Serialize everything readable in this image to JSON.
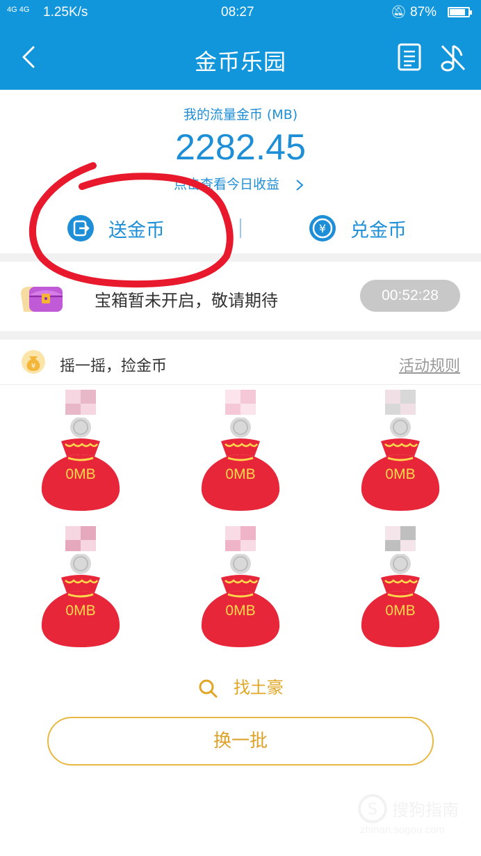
{
  "status_bar": {
    "network": "4G 4G",
    "speed": "1.25K/s",
    "time": "08:27",
    "battery": "87%",
    "battery_level": 0.87
  },
  "header": {
    "title": "金币乐园",
    "back_icon": "chevron-left-icon",
    "icons": [
      "document-icon",
      "music-off-icon"
    ]
  },
  "balance": {
    "label": "我的流量金币 (MB)",
    "value": "2282.45",
    "today_link": "点击查看今日收益"
  },
  "actions": {
    "send_label": "送金币",
    "exchange_label": "兑金币"
  },
  "treasure": {
    "text": "宝箱暂未开启，敬请期待",
    "timer": "00:52:28"
  },
  "shake": {
    "title": "摇一摇，捡金币",
    "rules_label": "活动规则",
    "bags": [
      {
        "amount": "0MB"
      },
      {
        "amount": "0MB"
      },
      {
        "amount": "0MB"
      },
      {
        "amount": "0MB"
      },
      {
        "amount": "0MB"
      },
      {
        "amount": "0MB"
      }
    ]
  },
  "find_rich_label": "找土豪",
  "refresh_label": "换一批",
  "watermark": {
    "name": "搜狗指南",
    "url": "zhinan.sogou.com"
  },
  "colors": {
    "primary": "#1296db",
    "accent_blue": "#1e8fd6",
    "bag_red": "#e8263a",
    "gold": "#e1a524",
    "annotation_red": "#e8192c"
  }
}
